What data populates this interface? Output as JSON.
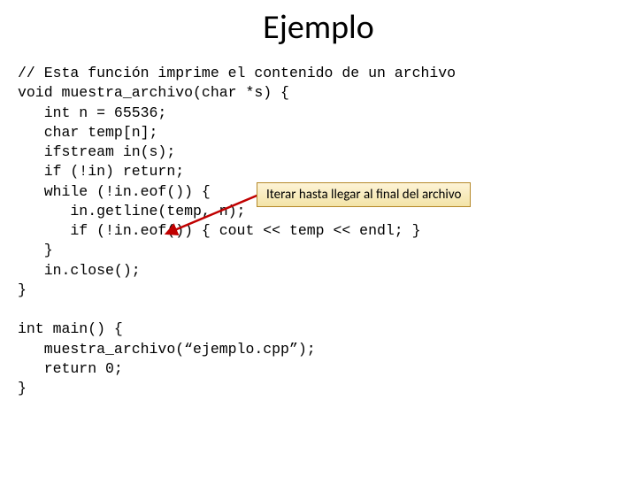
{
  "title": "Ejemplo",
  "code_lines": [
    "// Esta función imprime el contenido de un archivo",
    "void muestra_archivo(char *s) {",
    "   int n = 65536;",
    "   char temp[n];",
    "   ifstream in(s);",
    "   if (!in) return;",
    "   while (!in.eof()) {",
    "      in.getline(temp, n);",
    "      if (!in.eof()) { cout << temp << endl; }",
    "   }",
    "   in.close();",
    "}",
    "",
    "int main() {",
    "   muestra_archivo(“ejemplo.cpp”);",
    "   return 0;",
    "}"
  ],
  "callout": {
    "text": "Iterar hasta llegar al final del archivo",
    "arrow_color": "#c00000",
    "box_border": "#b5892a",
    "box_fill_top": "#fdf3d6",
    "box_fill_bottom": "#f3e4a8"
  }
}
